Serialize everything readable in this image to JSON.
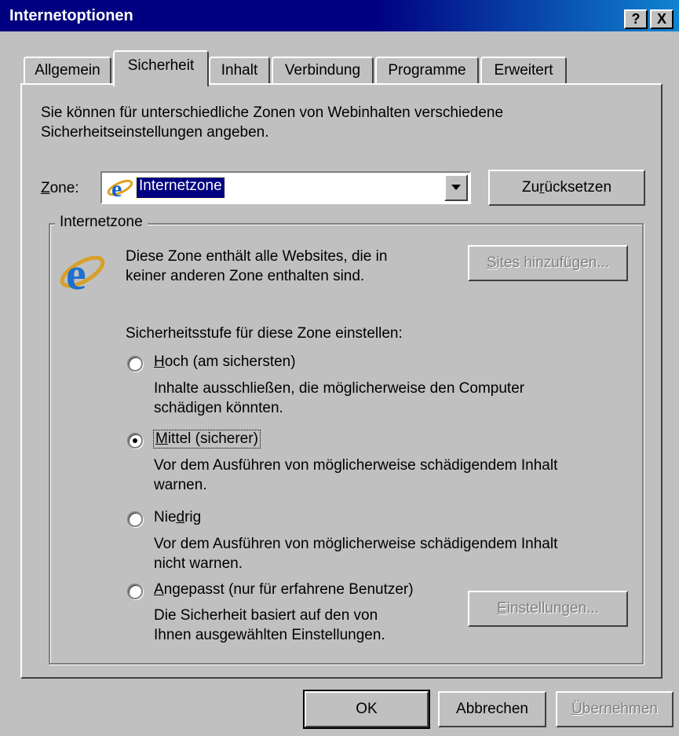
{
  "window": {
    "title": "Internetoptionen",
    "help_button": "?",
    "close_button": "X"
  },
  "tabs": [
    {
      "label": "Allgemein"
    },
    {
      "label": "Sicherheit"
    },
    {
      "label": "Inhalt"
    },
    {
      "label": "Verbindung"
    },
    {
      "label": "Programme"
    },
    {
      "label": "Erweitert"
    }
  ],
  "active_tab": "Sicherheit",
  "intro": {
    "line1": "Sie können für unterschiedliche Zonen von Webinhalten verschiedene",
    "line2": "Sicherheitseinstellungen angeben."
  },
  "zone": {
    "label_underlined": "Z",
    "label_rest": "one:",
    "selected": "Internetzone",
    "reset_pre": "Zu",
    "reset_underlined": "r",
    "reset_post": "ücksetzen"
  },
  "group": {
    "legend": "Internetzone",
    "desc_line1": "Diese Zone enthält alle Websites, die in",
    "desc_line2": "keiner anderen Zone enthalten sind.",
    "sites_underlined": "S",
    "sites_rest": "ites hinzufügen...",
    "level_label": "Sicherheitsstufe für diese Zone einstellen:"
  },
  "levels": [
    {
      "u": "H",
      "rest": "och (am sichersten)",
      "pre": "",
      "desc1": "Inhalte ausschließen, die möglicherweise den Computer",
      "desc2": "schädigen könnten.",
      "checked": false
    },
    {
      "u": "M",
      "rest": "ittel (sicherer)",
      "pre": "",
      "desc1": "Vor dem Ausführen von möglicherweise schädigendem Inhalt",
      "desc2": "warnen.",
      "checked": true
    },
    {
      "u": "d",
      "rest": "rig",
      "pre": "Nie",
      "desc1": "Vor dem Ausführen von möglicherweise schädigendem Inhalt",
      "desc2": "nicht warnen.",
      "checked": false
    },
    {
      "u": "A",
      "rest": "ngepasst (nur für erfahrene Benutzer)",
      "pre": "",
      "desc1": "Die Sicherheit basiert auf den von",
      "desc2": "Ihnen ausgewählten Einstellungen.",
      "checked": false
    }
  ],
  "settings_button": {
    "u": "E",
    "rest": "instellungen..."
  },
  "footer": {
    "ok": "OK",
    "cancel": "Abbrechen",
    "apply_u": "Ü",
    "apply_rest": "bernehmen"
  },
  "colors": {
    "face": "#c0c0c0",
    "titlebar": "#000080",
    "selection": "#000080",
    "disabled_text": "#808080"
  },
  "icons": [
    "ie-logo-icon",
    "dropdown-arrow-icon"
  ]
}
